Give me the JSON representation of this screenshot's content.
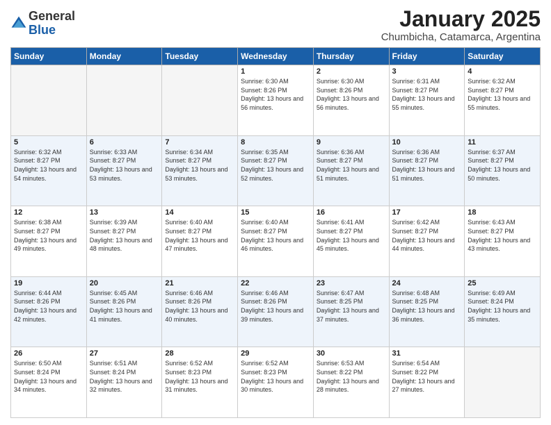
{
  "logo": {
    "general": "General",
    "blue": "Blue"
  },
  "title": "January 2025",
  "location": "Chumbicha, Catamarca, Argentina",
  "days_of_week": [
    "Sunday",
    "Monday",
    "Tuesday",
    "Wednesday",
    "Thursday",
    "Friday",
    "Saturday"
  ],
  "weeks": [
    [
      {
        "day": "",
        "sunrise": "",
        "sunset": "",
        "daylight": "",
        "empty": true
      },
      {
        "day": "",
        "sunrise": "",
        "sunset": "",
        "daylight": "",
        "empty": true
      },
      {
        "day": "",
        "sunrise": "",
        "sunset": "",
        "daylight": "",
        "empty": true
      },
      {
        "day": "1",
        "sunrise": "Sunrise: 6:30 AM",
        "sunset": "Sunset: 8:26 PM",
        "daylight": "Daylight: 13 hours and 56 minutes."
      },
      {
        "day": "2",
        "sunrise": "Sunrise: 6:30 AM",
        "sunset": "Sunset: 8:26 PM",
        "daylight": "Daylight: 13 hours and 56 minutes."
      },
      {
        "day": "3",
        "sunrise": "Sunrise: 6:31 AM",
        "sunset": "Sunset: 8:27 PM",
        "daylight": "Daylight: 13 hours and 55 minutes."
      },
      {
        "day": "4",
        "sunrise": "Sunrise: 6:32 AM",
        "sunset": "Sunset: 8:27 PM",
        "daylight": "Daylight: 13 hours and 55 minutes."
      }
    ],
    [
      {
        "day": "5",
        "sunrise": "Sunrise: 6:32 AM",
        "sunset": "Sunset: 8:27 PM",
        "daylight": "Daylight: 13 hours and 54 minutes."
      },
      {
        "day": "6",
        "sunrise": "Sunrise: 6:33 AM",
        "sunset": "Sunset: 8:27 PM",
        "daylight": "Daylight: 13 hours and 53 minutes."
      },
      {
        "day": "7",
        "sunrise": "Sunrise: 6:34 AM",
        "sunset": "Sunset: 8:27 PM",
        "daylight": "Daylight: 13 hours and 53 minutes."
      },
      {
        "day": "8",
        "sunrise": "Sunrise: 6:35 AM",
        "sunset": "Sunset: 8:27 PM",
        "daylight": "Daylight: 13 hours and 52 minutes."
      },
      {
        "day": "9",
        "sunrise": "Sunrise: 6:36 AM",
        "sunset": "Sunset: 8:27 PM",
        "daylight": "Daylight: 13 hours and 51 minutes."
      },
      {
        "day": "10",
        "sunrise": "Sunrise: 6:36 AM",
        "sunset": "Sunset: 8:27 PM",
        "daylight": "Daylight: 13 hours and 51 minutes."
      },
      {
        "day": "11",
        "sunrise": "Sunrise: 6:37 AM",
        "sunset": "Sunset: 8:27 PM",
        "daylight": "Daylight: 13 hours and 50 minutes."
      }
    ],
    [
      {
        "day": "12",
        "sunrise": "Sunrise: 6:38 AM",
        "sunset": "Sunset: 8:27 PM",
        "daylight": "Daylight: 13 hours and 49 minutes."
      },
      {
        "day": "13",
        "sunrise": "Sunrise: 6:39 AM",
        "sunset": "Sunset: 8:27 PM",
        "daylight": "Daylight: 13 hours and 48 minutes."
      },
      {
        "day": "14",
        "sunrise": "Sunrise: 6:40 AM",
        "sunset": "Sunset: 8:27 PM",
        "daylight": "Daylight: 13 hours and 47 minutes."
      },
      {
        "day": "15",
        "sunrise": "Sunrise: 6:40 AM",
        "sunset": "Sunset: 8:27 PM",
        "daylight": "Daylight: 13 hours and 46 minutes."
      },
      {
        "day": "16",
        "sunrise": "Sunrise: 6:41 AM",
        "sunset": "Sunset: 8:27 PM",
        "daylight": "Daylight: 13 hours and 45 minutes."
      },
      {
        "day": "17",
        "sunrise": "Sunrise: 6:42 AM",
        "sunset": "Sunset: 8:27 PM",
        "daylight": "Daylight: 13 hours and 44 minutes."
      },
      {
        "day": "18",
        "sunrise": "Sunrise: 6:43 AM",
        "sunset": "Sunset: 8:27 PM",
        "daylight": "Daylight: 13 hours and 43 minutes."
      }
    ],
    [
      {
        "day": "19",
        "sunrise": "Sunrise: 6:44 AM",
        "sunset": "Sunset: 8:26 PM",
        "daylight": "Daylight: 13 hours and 42 minutes."
      },
      {
        "day": "20",
        "sunrise": "Sunrise: 6:45 AM",
        "sunset": "Sunset: 8:26 PM",
        "daylight": "Daylight: 13 hours and 41 minutes."
      },
      {
        "day": "21",
        "sunrise": "Sunrise: 6:46 AM",
        "sunset": "Sunset: 8:26 PM",
        "daylight": "Daylight: 13 hours and 40 minutes."
      },
      {
        "day": "22",
        "sunrise": "Sunrise: 6:46 AM",
        "sunset": "Sunset: 8:26 PM",
        "daylight": "Daylight: 13 hours and 39 minutes."
      },
      {
        "day": "23",
        "sunrise": "Sunrise: 6:47 AM",
        "sunset": "Sunset: 8:25 PM",
        "daylight": "Daylight: 13 hours and 37 minutes."
      },
      {
        "day": "24",
        "sunrise": "Sunrise: 6:48 AM",
        "sunset": "Sunset: 8:25 PM",
        "daylight": "Daylight: 13 hours and 36 minutes."
      },
      {
        "day": "25",
        "sunrise": "Sunrise: 6:49 AM",
        "sunset": "Sunset: 8:24 PM",
        "daylight": "Daylight: 13 hours and 35 minutes."
      }
    ],
    [
      {
        "day": "26",
        "sunrise": "Sunrise: 6:50 AM",
        "sunset": "Sunset: 8:24 PM",
        "daylight": "Daylight: 13 hours and 34 minutes."
      },
      {
        "day": "27",
        "sunrise": "Sunrise: 6:51 AM",
        "sunset": "Sunset: 8:24 PM",
        "daylight": "Daylight: 13 hours and 32 minutes."
      },
      {
        "day": "28",
        "sunrise": "Sunrise: 6:52 AM",
        "sunset": "Sunset: 8:23 PM",
        "daylight": "Daylight: 13 hours and 31 minutes."
      },
      {
        "day": "29",
        "sunrise": "Sunrise: 6:52 AM",
        "sunset": "Sunset: 8:23 PM",
        "daylight": "Daylight: 13 hours and 30 minutes."
      },
      {
        "day": "30",
        "sunrise": "Sunrise: 6:53 AM",
        "sunset": "Sunset: 8:22 PM",
        "daylight": "Daylight: 13 hours and 28 minutes."
      },
      {
        "day": "31",
        "sunrise": "Sunrise: 6:54 AM",
        "sunset": "Sunset: 8:22 PM",
        "daylight": "Daylight: 13 hours and 27 minutes."
      },
      {
        "day": "",
        "sunrise": "",
        "sunset": "",
        "daylight": "",
        "empty": true
      }
    ]
  ]
}
